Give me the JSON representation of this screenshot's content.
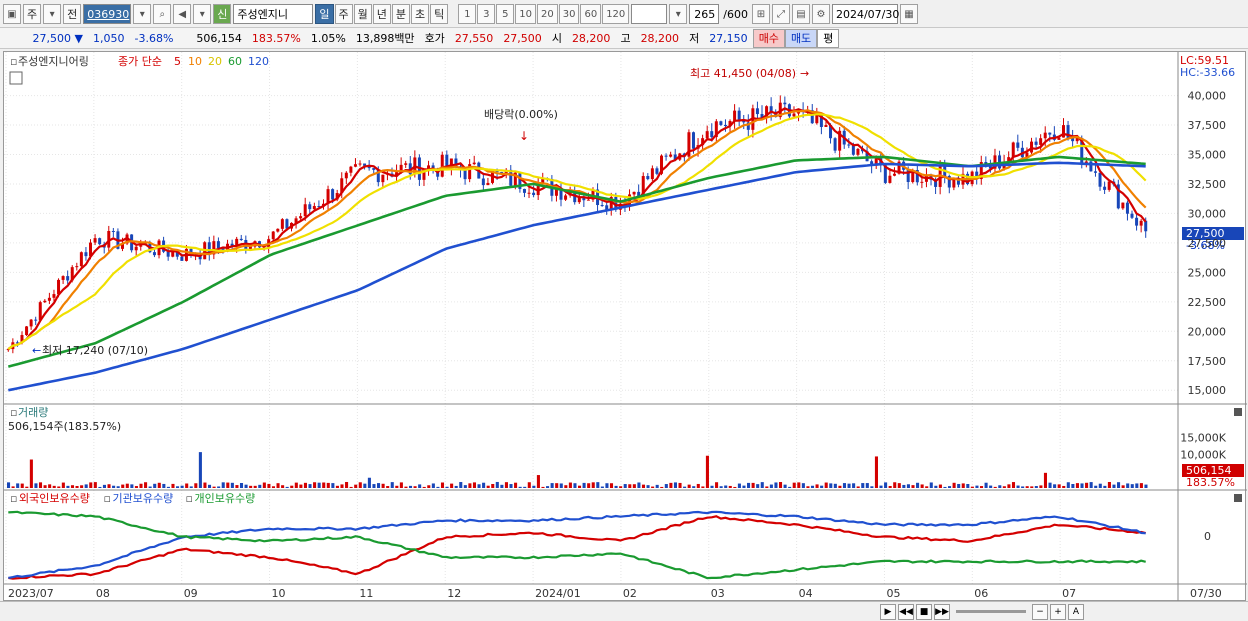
{
  "toolbar": {
    "market": "주",
    "prev": "전",
    "code": "036930",
    "stock_name": "주성엔지니",
    "new_badge": "신",
    "periods": [
      "일",
      "주",
      "월",
      "년",
      "분",
      "초",
      "틱"
    ],
    "active_period": "일",
    "intervals": [
      "1",
      "3",
      "5",
      "10",
      "20",
      "30",
      "60",
      "120"
    ],
    "count": "265",
    "count_total": "/600",
    "date": "2024/07/30"
  },
  "quote": {
    "price": "27,500",
    "change": "1,050",
    "change_pct": "-3.68%",
    "volume": "506,154",
    "volume_ratio": "183.57%",
    "turnover": "1.05%",
    "amount": "13,898백만",
    "ask_label": "호가",
    "ask": "27,550",
    "bid": "27,500",
    "open_label": "시",
    "open": "28,200",
    "high_label": "고",
    "high": "28,200",
    "low_label": "저",
    "low": "27,150",
    "buy_label": "매수",
    "sell_label": "매도",
    "flat_label": "평"
  },
  "price_panel": {
    "title": "주성엔지니어링",
    "ma_label": "종가 단순",
    "ma_periods": [
      "5",
      "10",
      "20",
      "60",
      "120"
    ],
    "ma_colors": [
      "#d40000",
      "#f08000",
      "#f0e000",
      "#1a9a30",
      "#2050d0"
    ],
    "lc": "LC:59.51",
    "hc": "HC:-33.66",
    "y_ticks": [
      "40,000",
      "37,500",
      "35,000",
      "32,500",
      "30,000",
      "27,500",
      "25,000",
      "22,500",
      "20,000",
      "17,500",
      "15,000"
    ],
    "current_price": "27,500",
    "current_pct": "-3.68%",
    "max_label": "최고 41,450 (04/08)",
    "min_label": "최저 17,240 (07/10)",
    "dividend_label": "배당락(0.00%)"
  },
  "volume_panel": {
    "title": "거래량",
    "summary": "506,154주(183.57%)",
    "y_ticks": [
      "15,000K",
      "10,000K",
      "5,000K"
    ],
    "current": "506,154",
    "current_pct": "183.57%"
  },
  "holding_panel": {
    "series": [
      {
        "name": "외국인보유수량",
        "color": "#d40000"
      },
      {
        "name": "기관보유수량",
        "color": "#2050d0"
      },
      {
        "name": "개인보유수량",
        "color": "#1a9a30"
      }
    ],
    "zero_label": "0"
  },
  "x_axis": {
    "labels": [
      "2023/07",
      "08",
      "09",
      "10",
      "11",
      "12",
      "2024/01",
      "02",
      "03",
      "04",
      "05",
      "06",
      "07"
    ],
    "last_label": "07/30"
  },
  "chart_data": {
    "type": "line",
    "title": "주성엔지니어링",
    "x": [
      "2023/07",
      "08",
      "09",
      "10",
      "11",
      "12",
      "2024/01",
      "02",
      "03",
      "04",
      "05",
      "06",
      "07",
      "07/30"
    ],
    "series": [
      {
        "name": "종가 단순 5",
        "values": [
          18500,
          28000,
          26500,
          28000,
          33500,
          34000,
          32500,
          31000,
          37500,
          38500,
          33500,
          33000,
          37500,
          28500
        ]
      },
      {
        "name": "종가 단순 60",
        "values": [
          17000,
          19000,
          22500,
          26500,
          29000,
          31500,
          32500,
          31000,
          33000,
          34500,
          34800,
          34000,
          34800,
          34200
        ]
      },
      {
        "name": "종가 단순 120",
        "values": [
          15000,
          16500,
          18500,
          21000,
          23500,
          27000,
          29000,
          30500,
          32000,
          33500,
          34200,
          34000,
          34300,
          34000
        ]
      },
      {
        "name": "외국인보유수량",
        "values": [
          -0.9,
          -0.8,
          -0.2,
          -0.4,
          -0.8,
          0.1,
          0.2,
          0.0,
          0.6,
          0.4,
          0.1,
          0.0,
          0.4,
          0.2
        ]
      },
      {
        "name": "기관보유수량",
        "values": [
          -0.9,
          -0.6,
          0.1,
          0.3,
          0.3,
          0.5,
          0.5,
          0.6,
          0.7,
          0.6,
          0.4,
          0.4,
          0.6,
          0.2
        ]
      },
      {
        "name": "개인보유수량",
        "values": [
          0.7,
          0.6,
          0.1,
          0.0,
          0.1,
          -0.4,
          -0.4,
          -0.3,
          -0.9,
          -0.7,
          -0.5,
          -0.5,
          -0.5,
          -0.5
        ]
      }
    ],
    "ylim": [
      14000,
      42000
    ],
    "grid": true
  }
}
